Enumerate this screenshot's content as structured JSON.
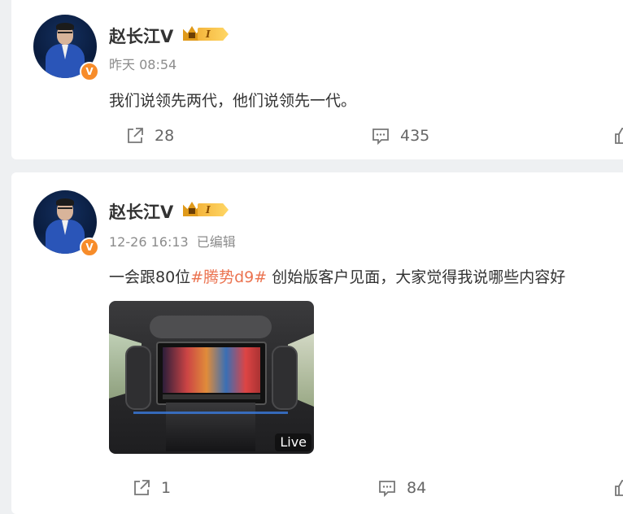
{
  "posts": [
    {
      "author": "赵长江V",
      "level": "I",
      "verified_badge": "V",
      "time": "昨天 08:54",
      "edited": "",
      "text_segments": [
        {
          "text": "我们说领先两代，他们说领先一代。",
          "type": "plain"
        }
      ],
      "actions": {
        "share_count": "28",
        "comment_count": "435"
      }
    },
    {
      "author": "赵长江V",
      "level": "I",
      "verified_badge": "V",
      "time": "12-26 16:13",
      "edited": "已编辑",
      "text_segments": [
        {
          "text": "一会跟80位",
          "type": "plain"
        },
        {
          "text": "#腾势d9#",
          "type": "topic"
        },
        {
          "text": " 创始版客户见面，大家觉得我说哪些内容好",
          "type": "plain"
        }
      ],
      "media": {
        "live_badge": "Live"
      },
      "actions": {
        "share_count": "1",
        "comment_count": "84"
      }
    }
  ],
  "colors": {
    "topic": "#eb7350",
    "badge": "#f78c2a",
    "text": "#333333",
    "meta": "#8c8c8c"
  }
}
